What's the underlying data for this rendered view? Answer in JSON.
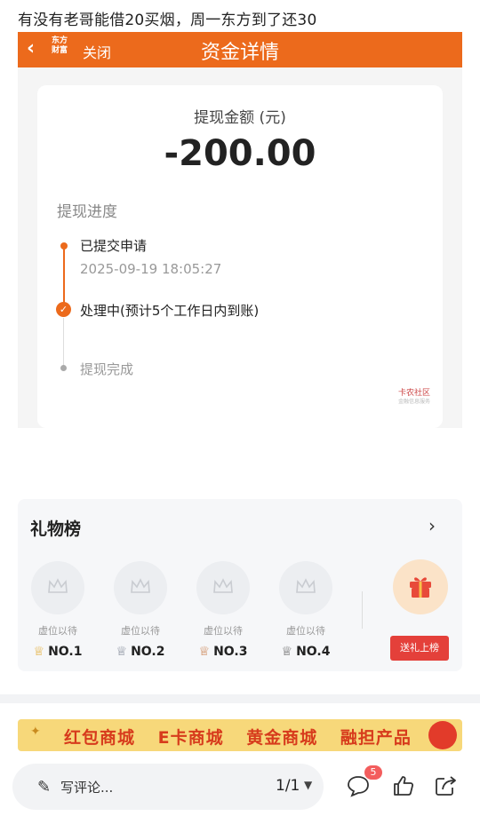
{
  "post": {
    "title": "有没有老哥能借20买烟，周一东方到了还30"
  },
  "screenshot": {
    "nav": {
      "back_icon": "chevron-left-icon",
      "logo_text": "东方财富",
      "close_label": "关闭",
      "title": "资金详情",
      "bar_color": "#ec6a1c"
    },
    "amount_label": "提现金额 (元)",
    "amount_value": "-200.00",
    "progress_title": "提现进度",
    "steps": [
      {
        "label": "已提交申请",
        "time": "2025-09-19 18:05:27"
      },
      {
        "label": "处理中(预计5个工作日内到账)"
      },
      {
        "label": "提现完成"
      }
    ],
    "watermark": {
      "text": "卡农社区",
      "sub": "金融信息服务"
    }
  },
  "gift_board": {
    "title": "礼物榜",
    "slots": [
      {
        "text": "虚位以待",
        "rank": "NO.1"
      },
      {
        "text": "虚位以待",
        "rank": "NO.2"
      },
      {
        "text": "虚位以待",
        "rank": "NO.3"
      },
      {
        "text": "虚位以待",
        "rank": "NO.4"
      }
    ],
    "send_label": "送礼上榜"
  },
  "banner": {
    "items": [
      "红包商城",
      "E卡商城",
      "黄金商城",
      "融担产品"
    ]
  },
  "bottom_bar": {
    "comment_placeholder": "写评论...",
    "pager": "1/1",
    "comment_count": "5"
  },
  "colors": {
    "accent": "#ec6a1c",
    "send_button": "#e4403a",
    "badge": "#f35d5d"
  }
}
